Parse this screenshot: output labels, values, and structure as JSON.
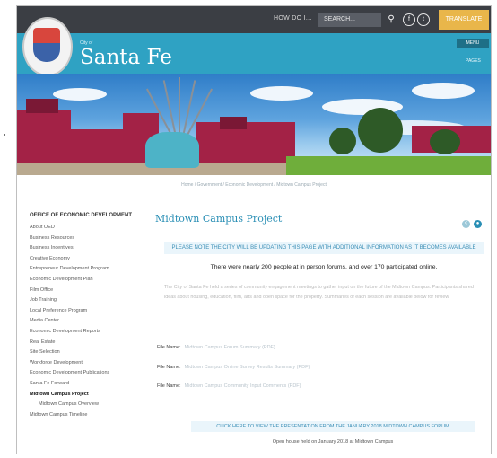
{
  "topbar": {
    "link_1": "HOW DO I...",
    "search_placeholder": "SEARCH...",
    "lang_label": "TRANSLATE"
  },
  "header": {
    "brand_small": "City of",
    "brand": "Santa Fe",
    "menu_label": "MENU",
    "right_label": "PAGES"
  },
  "breadcrumb": "Home / Government / Economic Development / Midtown Campus Project",
  "sidebar": {
    "title": "OFFICE OF ECONOMIC DEVELOPMENT",
    "items": [
      {
        "label": "About OED",
        "active": false,
        "sub": false
      },
      {
        "label": "Business Resources",
        "active": false,
        "sub": false
      },
      {
        "label": "Business Incentives",
        "active": false,
        "sub": false
      },
      {
        "label": "Creative Economy",
        "active": false,
        "sub": false
      },
      {
        "label": "Entrepreneur Development Program",
        "active": false,
        "sub": false
      },
      {
        "label": "Economic Development Plan",
        "active": false,
        "sub": false
      },
      {
        "label": "Film Office",
        "active": false,
        "sub": false
      },
      {
        "label": "Job Training",
        "active": false,
        "sub": false
      },
      {
        "label": "Local Preference Program",
        "active": false,
        "sub": false
      },
      {
        "label": "Media Center",
        "active": false,
        "sub": false
      },
      {
        "label": "Economic Development Reports",
        "active": false,
        "sub": false
      },
      {
        "label": "Real Estate",
        "active": false,
        "sub": false
      },
      {
        "label": "Site Selection",
        "active": false,
        "sub": false
      },
      {
        "label": "Workforce Development",
        "active": false,
        "sub": false
      },
      {
        "label": "Economic Development Publications",
        "active": false,
        "sub": false
      },
      {
        "label": "Santa Fe Forward",
        "active": false,
        "sub": false
      },
      {
        "label": "Midtown Campus Project",
        "active": true,
        "sub": false
      },
      {
        "label": "Midtown Campus Overview",
        "active": false,
        "sub": true
      },
      {
        "label": "Midtown Campus Timeline",
        "active": false,
        "sub": false
      }
    ]
  },
  "main": {
    "title": "Midtown Campus Project",
    "notice_top": "PLEASE NOTE THE CITY WILL BE UPDATING THIS PAGE WITH ADDITIONAL INFORMATION AS IT BECOMES AVAILABLE",
    "summary": "There were nearly 200 people at in person forums, and over 170 participated online.",
    "paragraph": "The City of Santa Fe held a series of community engagement meetings to gather input on the future of the Midtown Campus. Participants shared ideas about housing, education, film, arts and open space for the property. Summaries of each session are available below for review.",
    "files": [
      {
        "label": "File Name:",
        "link": "Midtown Campus Forum Summary (PDF)"
      },
      {
        "label": "File Name:",
        "link": "Midtown Campus Online Survey Results Summary (PDF)"
      },
      {
        "label": "File Name:",
        "link": "Midtown Campus Community Input Comments (PDF)"
      }
    ],
    "notice_bottom": "CLICK HERE TO VIEW THE PRESENTATION FROM THE JANUARY 2018 MIDTOWN CAMPUS FORUM",
    "bottom_text": "Open house held on January 2018 at Midtown Campus"
  },
  "colors": {
    "topbar": "#3b3e44",
    "header_blue": "#2fa2c3",
    "accent_gold": "#e9b64a",
    "link_blue": "#2a8fb5"
  }
}
